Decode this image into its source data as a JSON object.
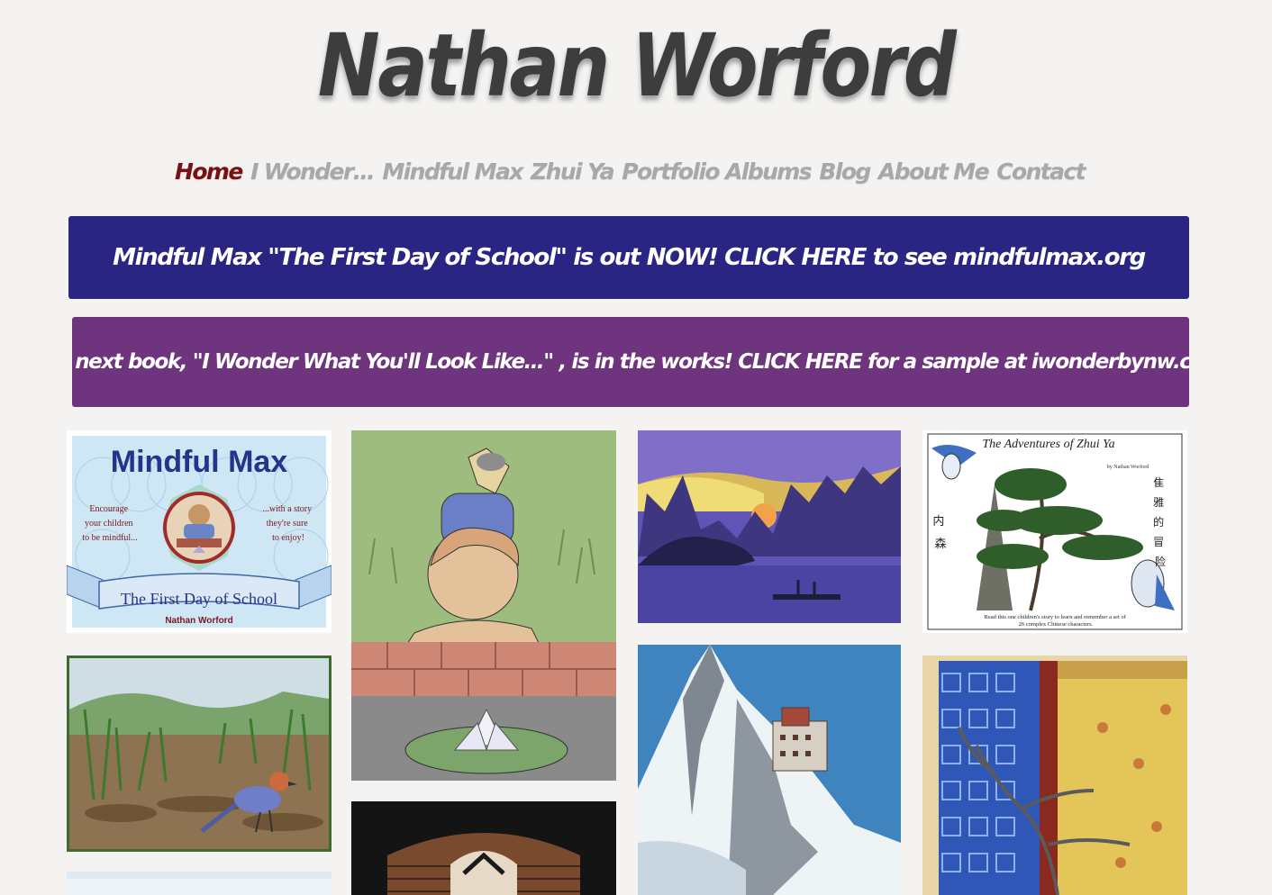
{
  "site": {
    "title": "Nathan Worford"
  },
  "nav": {
    "items": [
      "Home",
      "I Wonder…",
      "Mindful Max",
      "Zhui Ya",
      "Portfolio Albums",
      "Blog",
      "About Me",
      "Contact"
    ],
    "active": "Home"
  },
  "banners": [
    {
      "text": "Mindful Max \"The First Day of School\" is out NOW! CLICK HERE to see mindfulmax.org",
      "color": "#2a2583"
    },
    {
      "text": "My next book, \"I Wonder What You'll Look Like…\" , is in the works! CLICK HERE for a sample at iwonderbynw.com",
      "color": "#6e347e"
    }
  ],
  "gallery": {
    "mindful_max_cover": {
      "title": "Mindful Max",
      "left_text": [
        "Encourage",
        "your children",
        "to be mindful..."
      ],
      "right_text": [
        "...with a story",
        "they're sure",
        "to enjoy!"
      ],
      "ribbon": "The First Day of School",
      "author": "Nathan Worford"
    },
    "zhui_ya_cover": {
      "title": "The Adventures of Zhui Ya",
      "byline": "by Nathan Worford",
      "chars_right": [
        "隹",
        "雅",
        "的",
        "冒",
        "险"
      ],
      "chars_left": [
        "内",
        "森"
      ],
      "footer": [
        "Read this one children's story to learn and remember a set of",
        "26 complex Chinese characters."
      ]
    }
  },
  "colors": {
    "nav_active": "#7b1010",
    "nav_inactive": "#a8a8a8",
    "title": "#3d3d3d",
    "background": "#f4f3f1"
  }
}
